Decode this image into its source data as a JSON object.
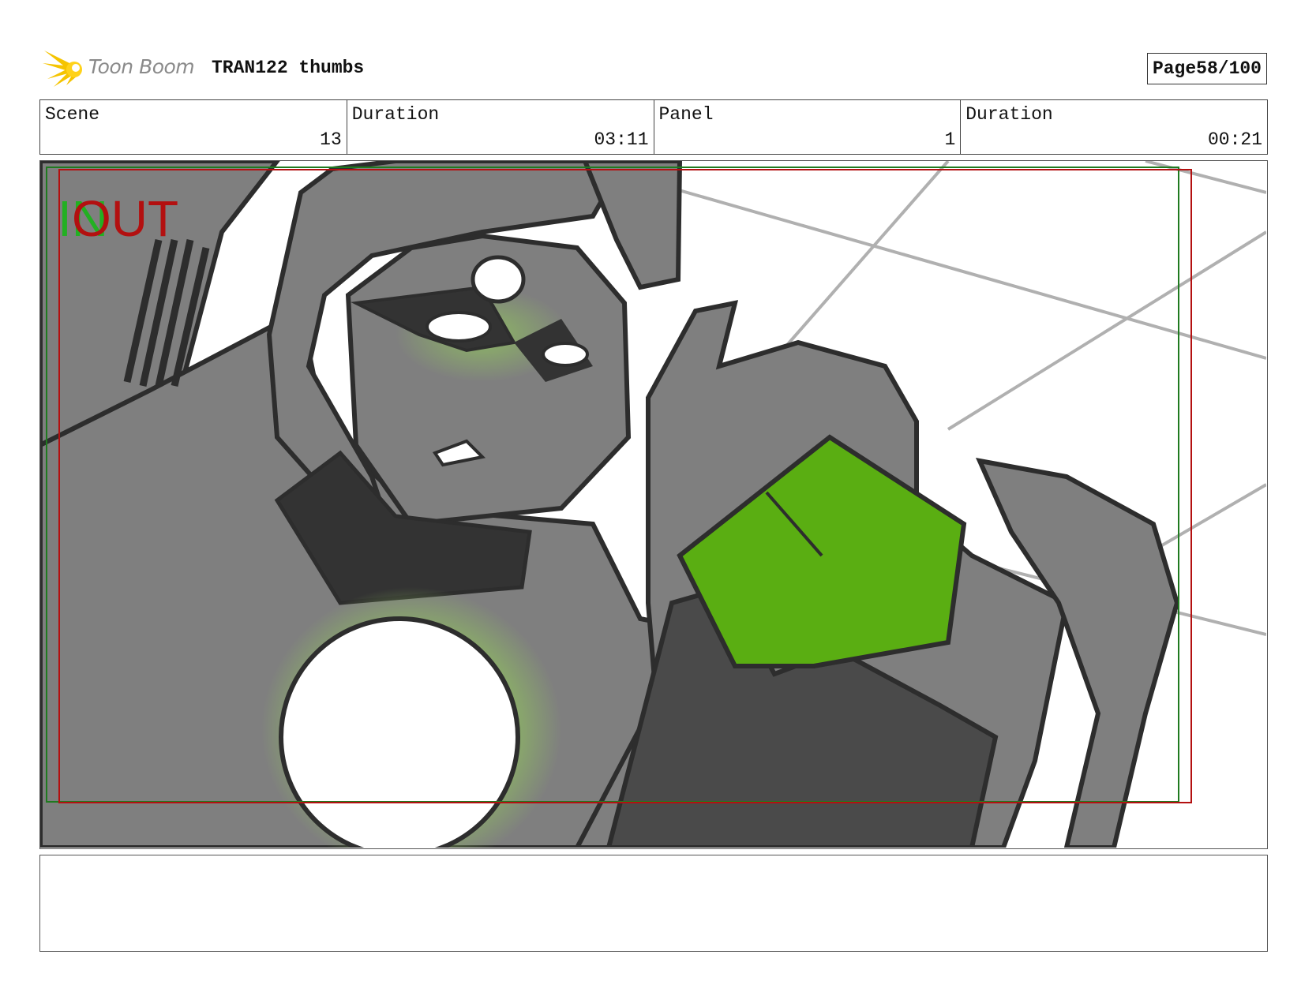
{
  "header": {
    "logo_text": "Toon Boom",
    "title": "TRAN122 thumbs",
    "page_label": "Page",
    "page_value": "58/100"
  },
  "info": {
    "scene_label": "Scene",
    "scene_value": "13",
    "scene_duration_label": "Duration",
    "scene_duration_value": "03:11",
    "panel_label": "Panel",
    "panel_value": "1",
    "panel_duration_label": "Duration",
    "panel_duration_value": "00:21"
  },
  "frame": {
    "in_marker": "IN",
    "out_marker": "OUT",
    "colors": {
      "in_marker": "#22b022",
      "out_marker": "#b31010",
      "figure": "#7f7f7f",
      "shadow": "#333333",
      "gem": "#5aae12",
      "glow": "#8fbf60"
    }
  },
  "notes": {
    "text": ""
  }
}
